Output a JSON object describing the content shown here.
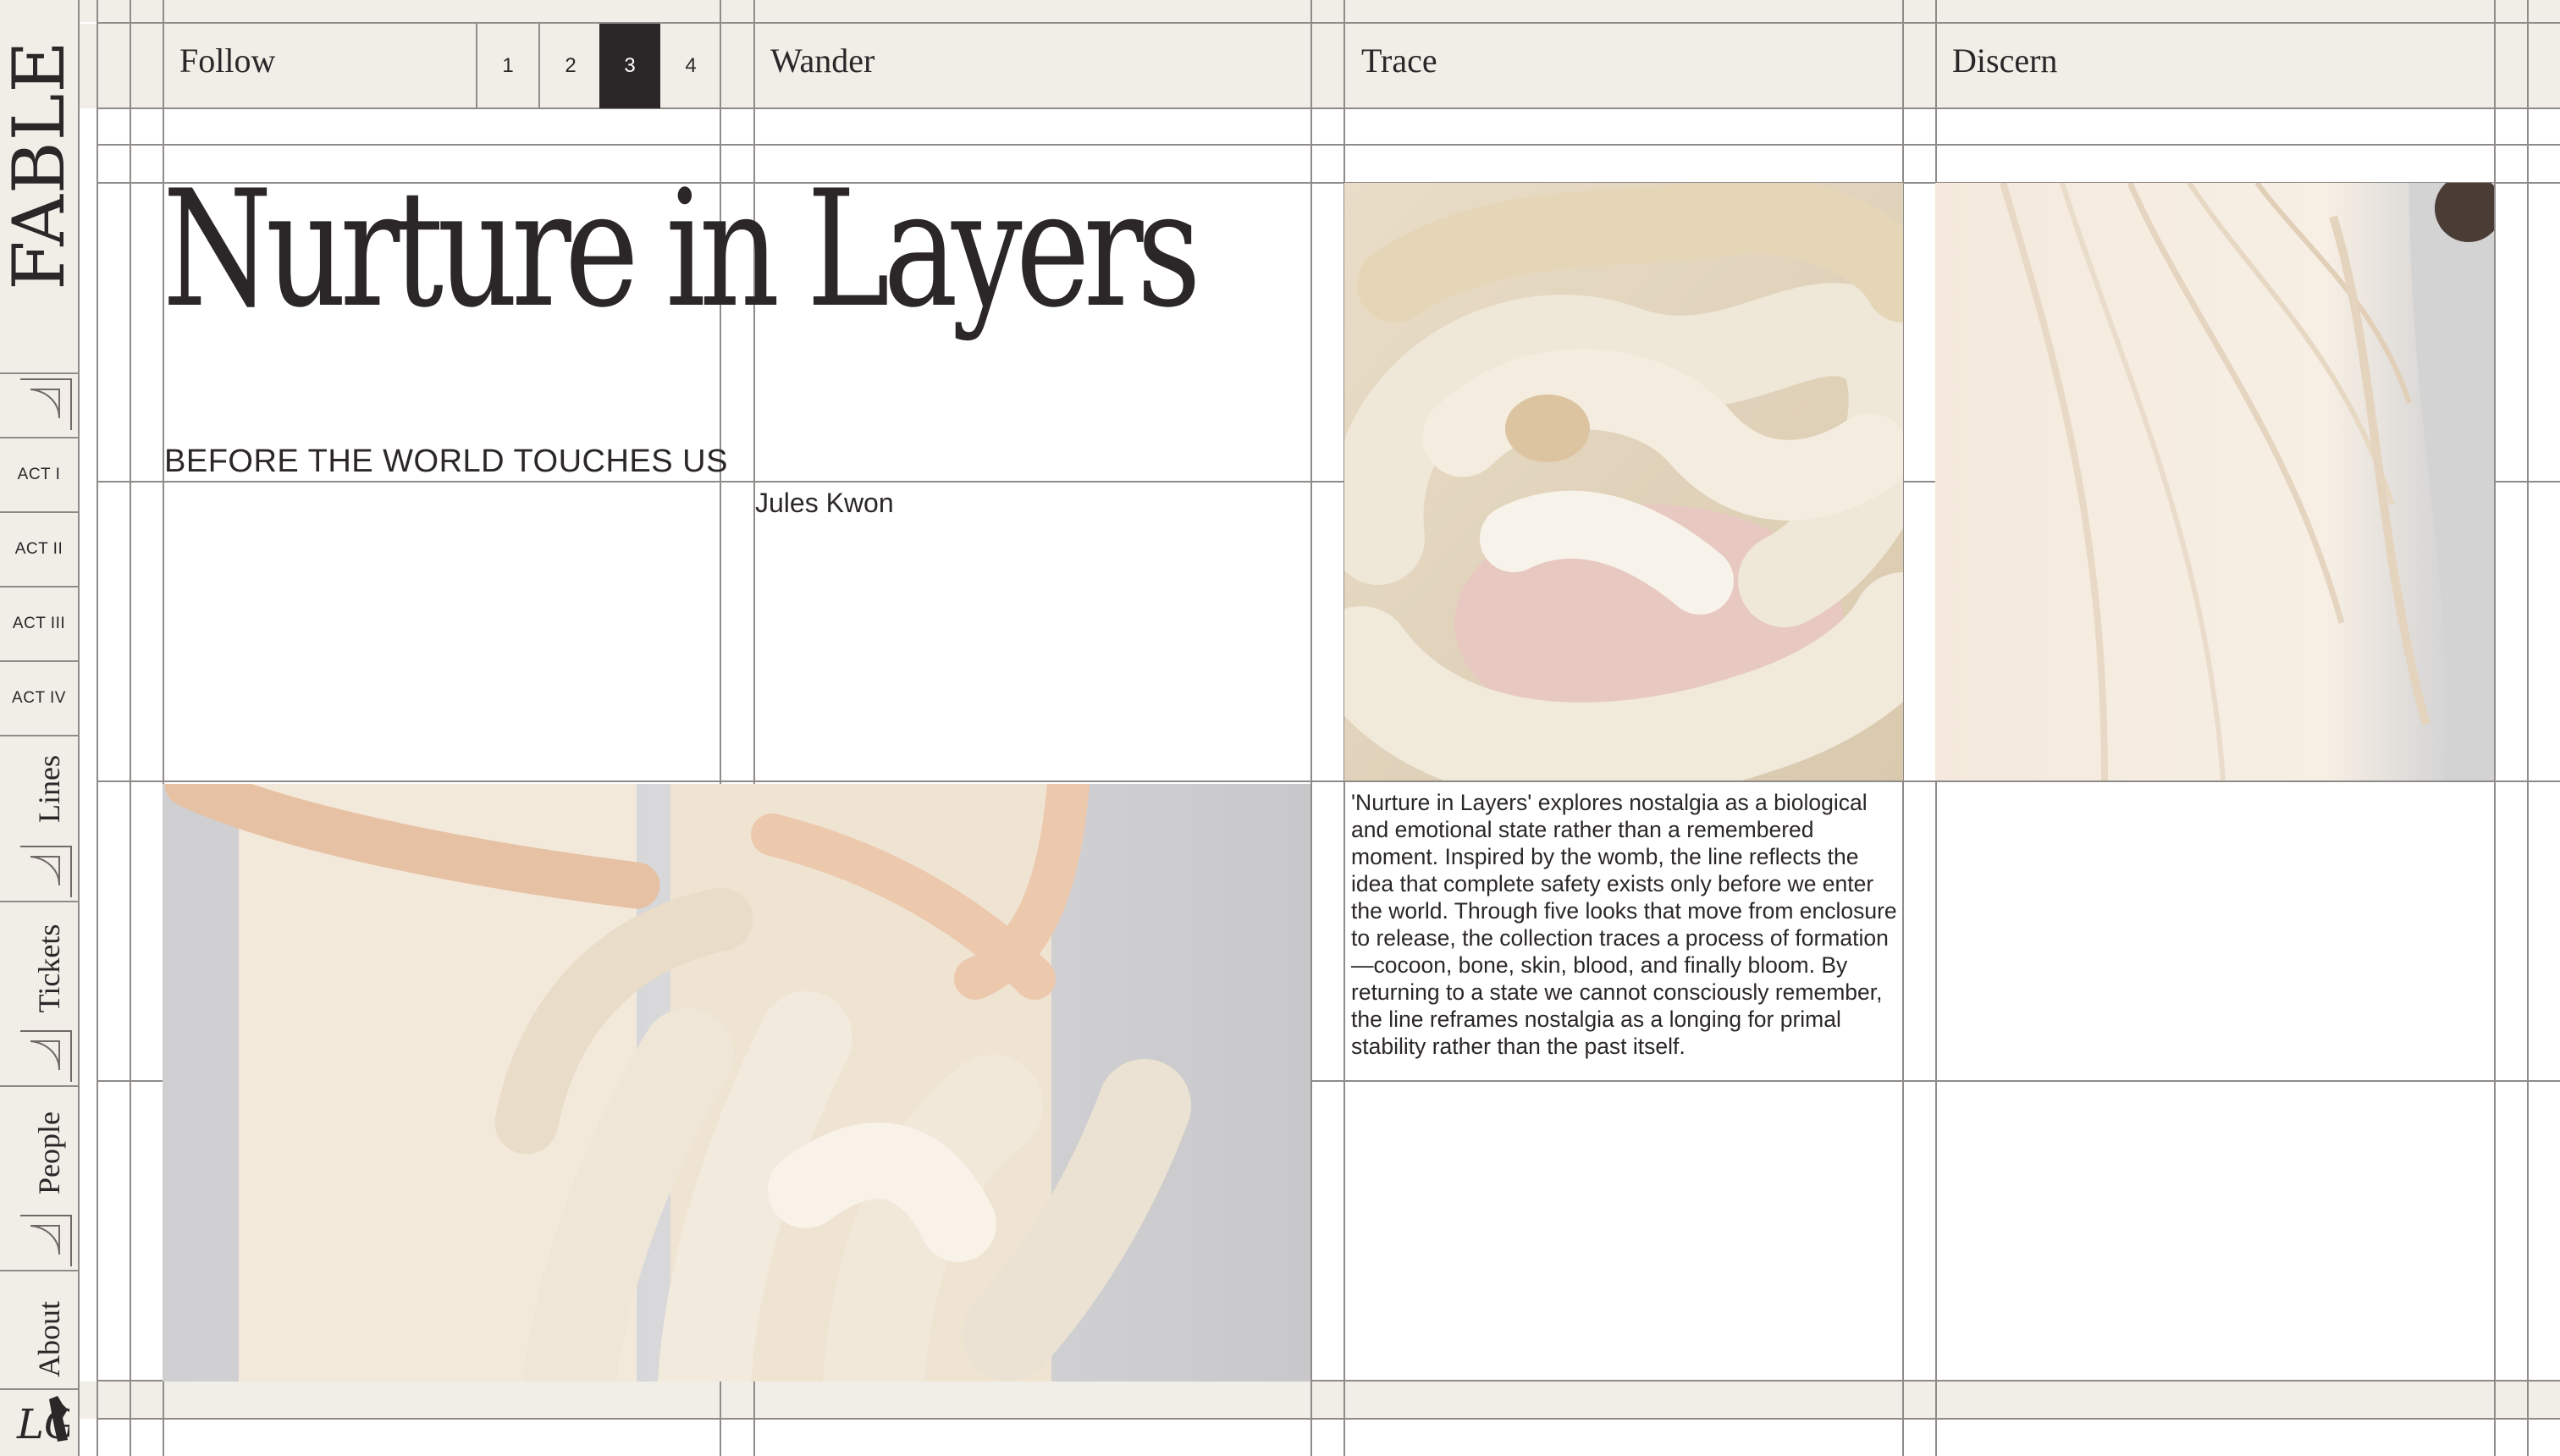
{
  "brand": {
    "logo": "FABLE",
    "mark": "LG"
  },
  "sidebar": {
    "acts": [
      "ACT I",
      "ACT II",
      "ACT III",
      "ACT IV"
    ],
    "links": [
      "Lines",
      "Tickets",
      "People",
      "About"
    ]
  },
  "header": {
    "follow_label": "Follow",
    "pages": [
      "1",
      "2",
      "3",
      "4"
    ],
    "active_page": "3",
    "wander_label": "Wander",
    "trace_label": "Trace",
    "discern_label": "Discern"
  },
  "main": {
    "title": "Nurture in Layers",
    "subtitle": "BEFORE THE WORLD TOUCHES US",
    "author": "Jules Kwon",
    "description": "'Nurture in Layers' explores nostalgia as a biological and emotional state rather than a remembered moment. Inspired by the womb, the line reflects the idea that complete safety exists only before we enter the world. Through five looks that move from enclosure to release, the collection traces a process of formation—cocoon, bone, skin, blood, and finally bloom. By returning to a state we cannot consciously remember, the line reframes nostalgia as a longing for primal stability rather than the past itself."
  },
  "colors": {
    "panel": "#f1eee8",
    "ink": "#2b2628",
    "gridline": "#8f8b89",
    "active_page_bg": "#2b2628"
  }
}
